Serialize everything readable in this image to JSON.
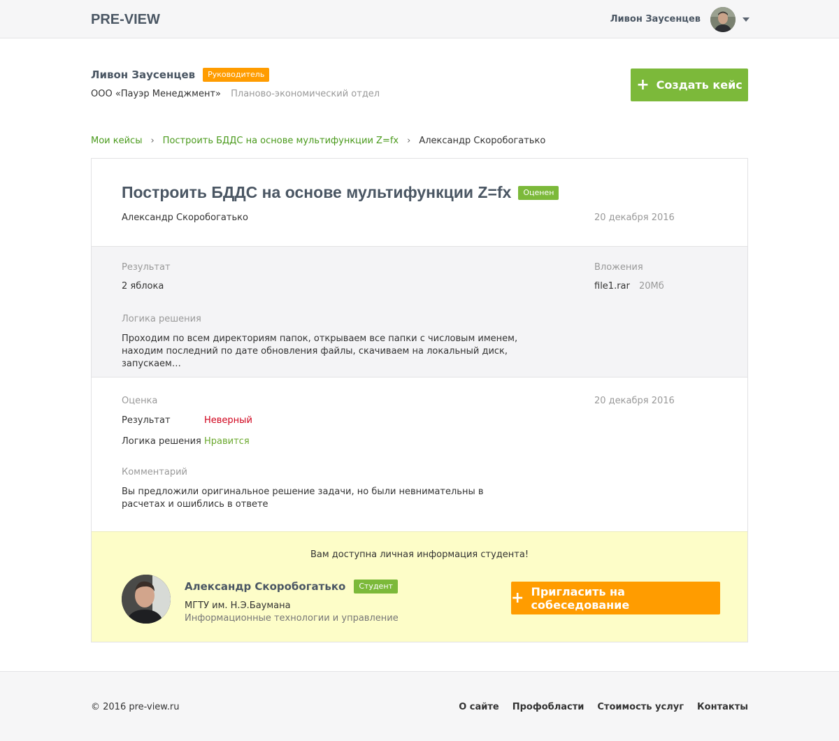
{
  "header": {
    "logo": "PRE-VIEW",
    "user_name": "Ливон Заусенцев"
  },
  "profile": {
    "name": "Ливон Заусенцев",
    "role_badge": "Руководитель",
    "company": "ООО «Пауэр Менеджмент»",
    "department": "Планово-экономический отдел",
    "create_button": "Создать кейс"
  },
  "breadcrumb": {
    "items": [
      "Мои кейсы",
      "Построить БДДС на основе мультифункции Z=fx",
      "Александр Скоробогатько"
    ],
    "separator": "›"
  },
  "case": {
    "title": "Построить БДДС на основе мультифункции Z=fx",
    "status_badge": "Оценен",
    "author": "Александр Скоробогатько",
    "date": "20 декабря 2016"
  },
  "result": {
    "result_label": "Результат",
    "result_value": "2 яблока",
    "attachments_label": "Вложения",
    "file_name": "file1.rar",
    "file_size": "20Мб",
    "logic_label": "Логика решения",
    "logic_text": "Проходим по всем директориям папок, открываем все папки с числовым именем, находим последний по дате обновления файлы, скачиваем на локальный диск, запускаем…"
  },
  "evaluation": {
    "label": "Оценка",
    "date": "20 декабря 2016",
    "result_label": "Результат",
    "result_value": "Неверный",
    "logic_label": "Логика решения",
    "logic_value": "Нравится",
    "comment_label": "Комментарий",
    "comment_text": "Вы предложили оригинальное решение задачи, но были невнимательны в расчетах и ошиблись в ответе"
  },
  "student": {
    "notice": "Вам доступна личная информация студента!",
    "name": "Александр Скоробогатько",
    "badge": "Студент",
    "university": "МГТУ им. Н.Э.Баумана",
    "faculty": "Информационные технологии и управление",
    "invite_button": "Пригласить на собеседование"
  },
  "footer": {
    "copyright": "© 2016 pre-view.ru",
    "links": [
      "О сайте",
      "Профобласти",
      "Стоимость услуг",
      "Контакты"
    ]
  },
  "colors": {
    "green": "#7cb93a",
    "orange": "#ff9c00",
    "red": "#d0021b",
    "highlight_bg": "#fdfdc8"
  }
}
